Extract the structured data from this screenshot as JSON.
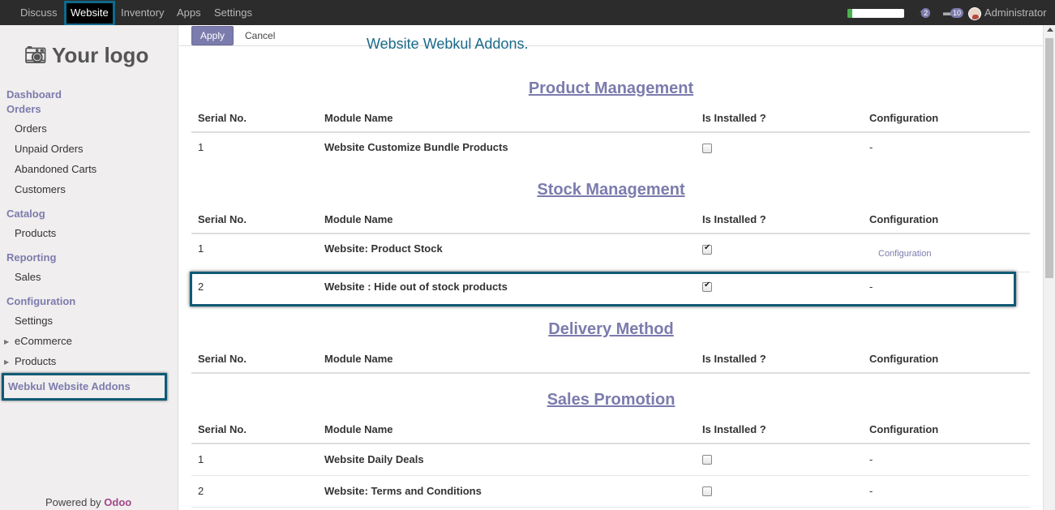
{
  "topbar": {
    "apps": [
      "Discuss",
      "Website",
      "Inventory",
      "Apps",
      "Settings"
    ],
    "active_app": "Website",
    "progress": 0.08,
    "chat_count": "2",
    "message_count": "10",
    "user": "Administrator"
  },
  "sidebar": {
    "logo_text": "Your logo",
    "sections": [
      {
        "title": "Dashboard",
        "items": []
      },
      {
        "title": "Orders",
        "items": [
          "Orders",
          "Unpaid Orders",
          "Abandoned Carts",
          "Customers"
        ]
      },
      {
        "title": "Catalog",
        "items": [
          "Products"
        ]
      },
      {
        "title": "Reporting",
        "items": [
          "Sales"
        ]
      },
      {
        "title": "Configuration",
        "items": [
          "Settings",
          "eCommerce",
          "Products"
        ]
      },
      {
        "title": "Webkul Website Addons",
        "items": []
      }
    ],
    "powered_by": "Powered by",
    "powered_brand": "Odoo"
  },
  "buttons": {
    "apply": "Apply",
    "cancel": "Cancel"
  },
  "page_heading": "Website Webkul Addons.",
  "table_headers": {
    "serial": "Serial No.",
    "module": "Module Name",
    "installed": "Is Installed ?",
    "config": "Configuration"
  },
  "sections": [
    {
      "title": "Product Management",
      "rows": [
        {
          "serial": "1",
          "name": "Website Customize Bundle Products",
          "installed": false,
          "config": "-"
        }
      ]
    },
    {
      "title": "Stock Management",
      "rows": [
        {
          "serial": "1",
          "name": "Website: Product Stock",
          "installed": true,
          "config": "Configuration"
        },
        {
          "serial": "2",
          "name": "Website : Hide out of stock products",
          "installed": true,
          "config": "-"
        }
      ]
    },
    {
      "title": "Delivery Method",
      "rows": []
    },
    {
      "title": "Sales Promotion",
      "rows": [
        {
          "serial": "1",
          "name": "Website Daily Deals",
          "installed": false,
          "config": "-"
        },
        {
          "serial": "2",
          "name": "Website: Terms and Conditions",
          "installed": false,
          "config": "-"
        }
      ]
    }
  ]
}
